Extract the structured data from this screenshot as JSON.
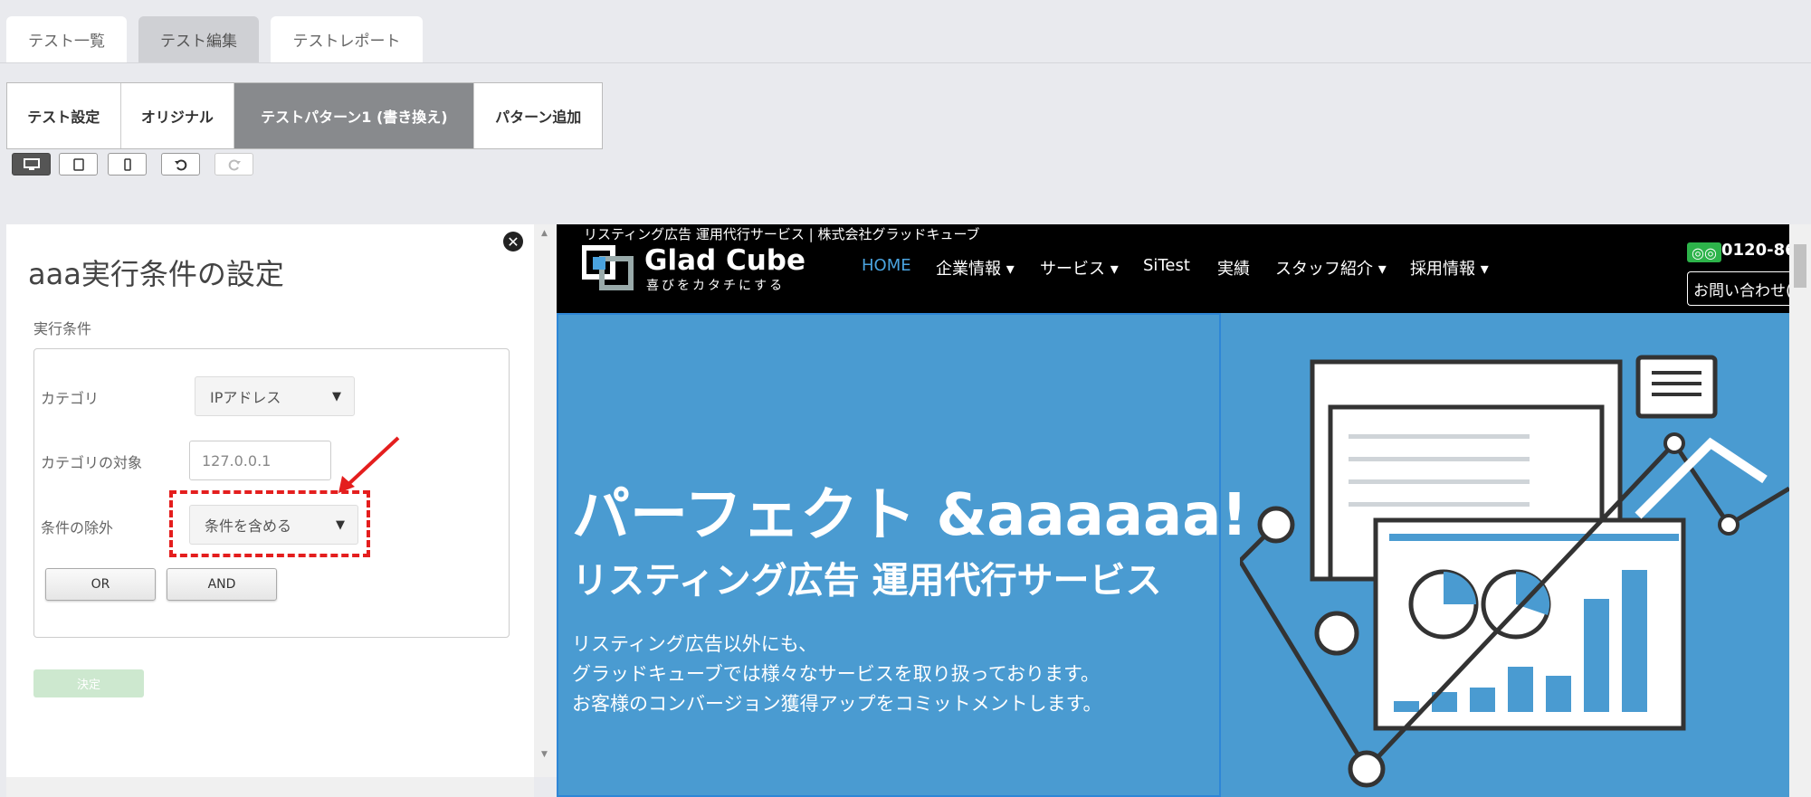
{
  "top_tabs": [
    "テスト一覧",
    "テスト編集",
    "テストレポート"
  ],
  "sub_tabs": [
    "テスト設定",
    "オリジナル",
    "テストパターン1 (書き換え)",
    "パターン追加"
  ],
  "panel": {
    "title": "aaa実行条件の設定",
    "section_label": "実行条件",
    "category_label": "カテゴリ",
    "category_value": "IPアドレス",
    "target_label": "カテゴリの対象",
    "target_value": "127.0.0.1",
    "exclude_label": "条件の除外",
    "exclude_value": "条件を含める",
    "or_label": "OR",
    "and_label": "AND",
    "submit_label": "決定"
  },
  "site": {
    "top_text": "リスティング広告 運用代行サービス | 株式会社グラッドキューブ",
    "logo_main": "Glad Cube",
    "logo_sub": "喜びをカタチにする",
    "nav": [
      "HOME",
      "企業情報 ▾",
      "サービス ▾",
      "SiTest",
      "実績",
      "スタッフ紹介 ▾",
      "採用情報 ▾"
    ],
    "phone": "0120-86",
    "contact": "お問い合わせ(",
    "hero_title": "パーフェクト &aaaaaa!",
    "hero_sub": "リスティング広告 運用代行サービス",
    "hero_lines": [
      "リスティング広告以外にも、",
      "グラッドキューブでは様々なサービスを取り扱っております。",
      "お客様のコンバージョン獲得アップをコミットメントします。"
    ]
  },
  "colors": {
    "accent_red": "#e41e1e",
    "site_blue": "#4a9bd1",
    "home_blue": "#4aa3df",
    "phone_green": "#2db34a"
  }
}
